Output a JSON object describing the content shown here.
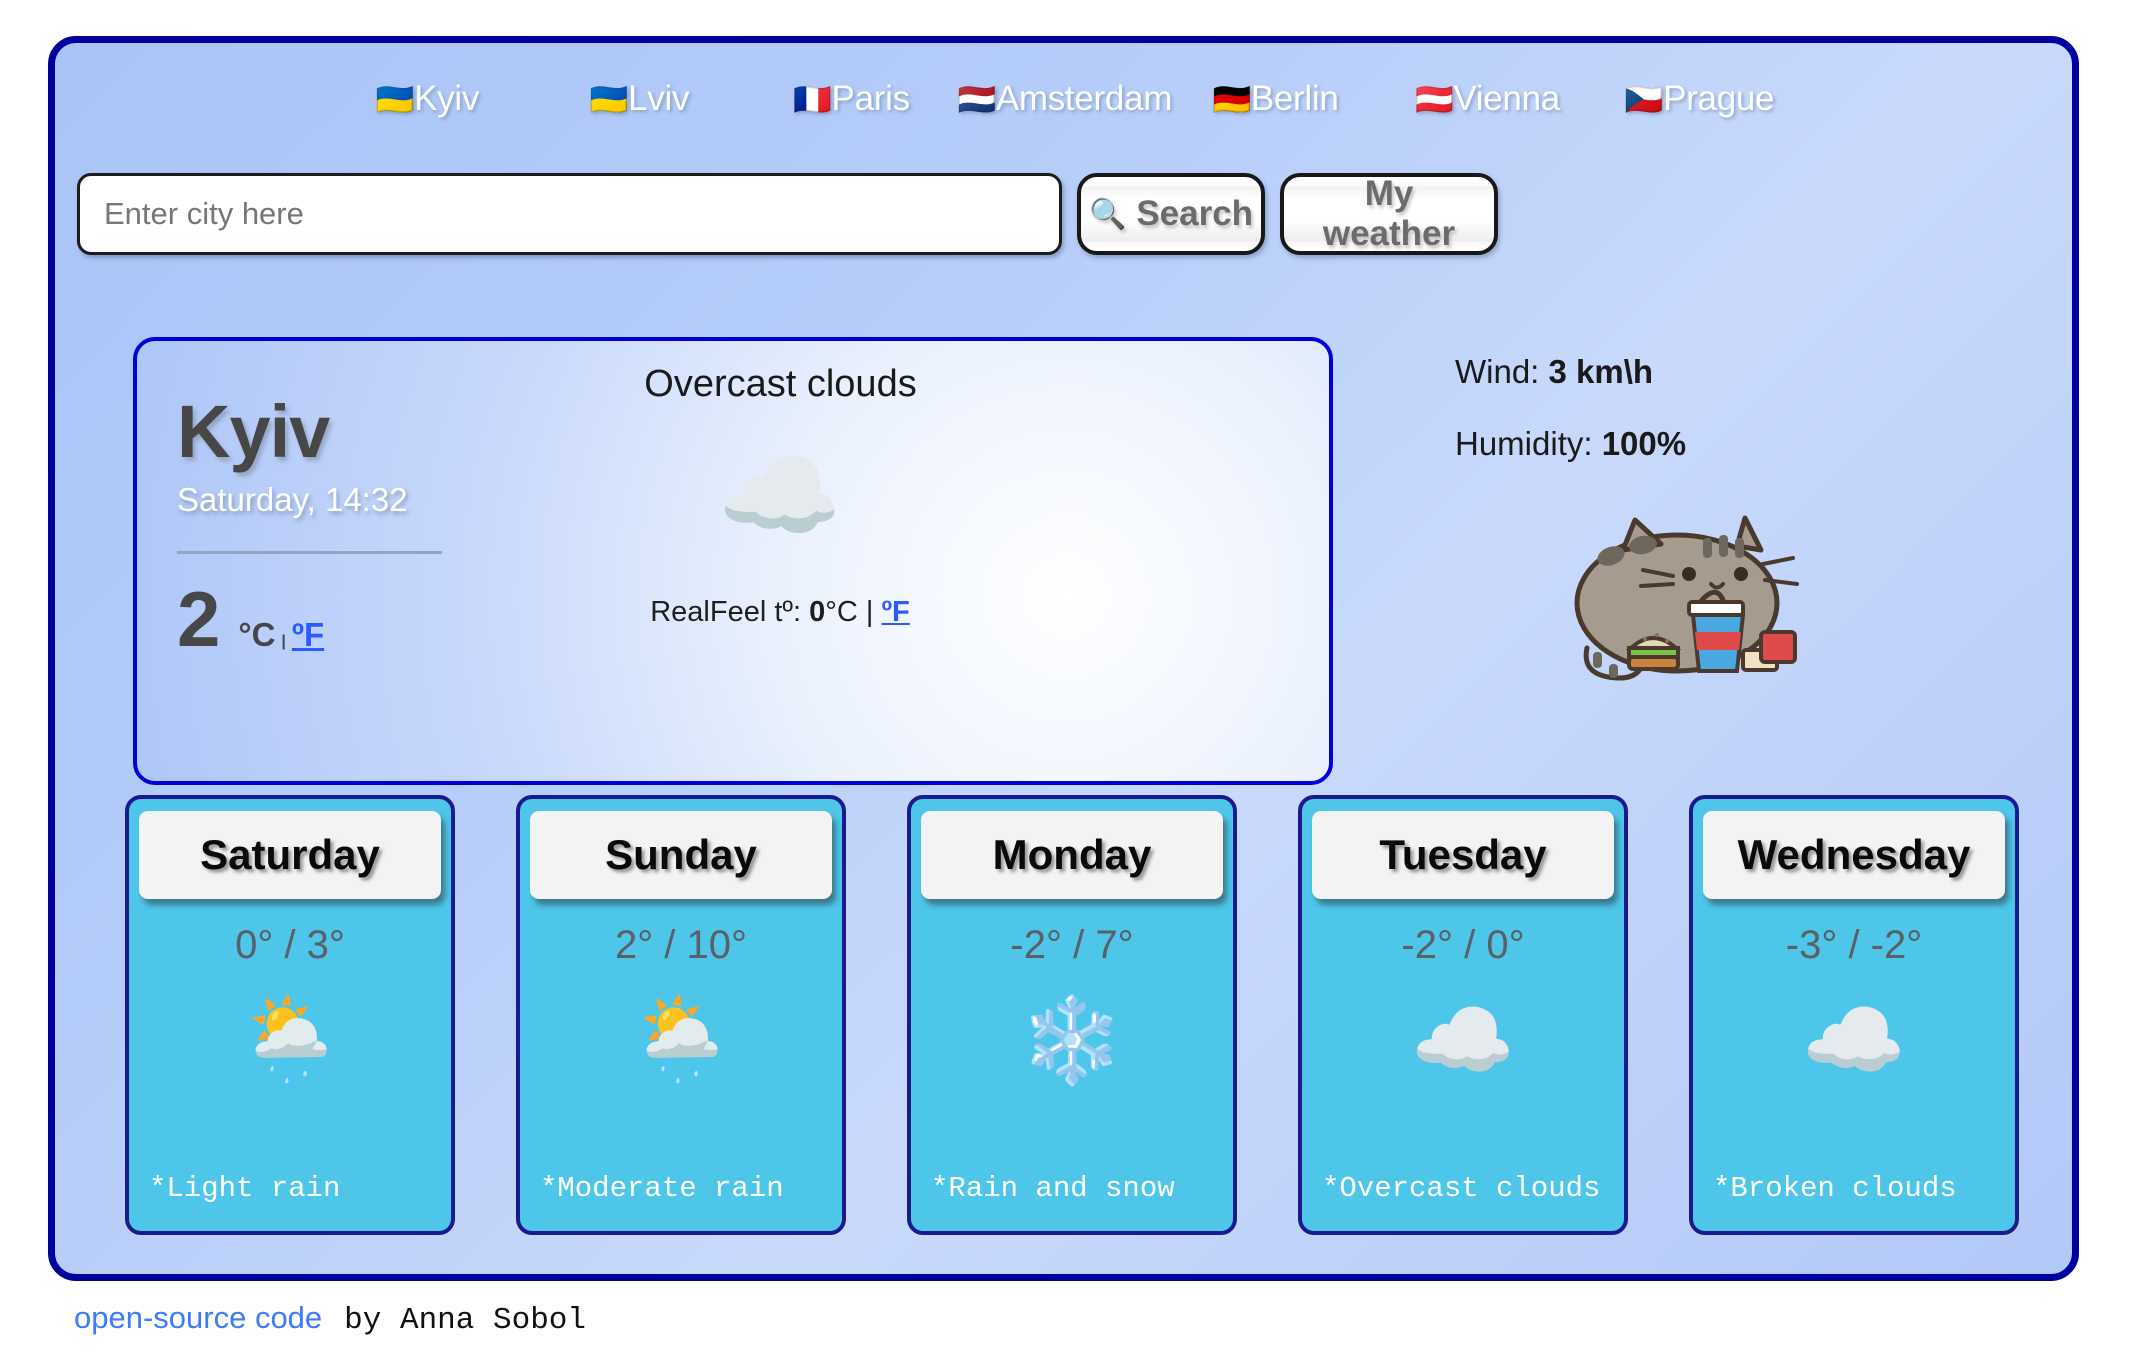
{
  "nav": {
    "items": [
      {
        "flag": "🇺🇦",
        "label": "Kyiv",
        "name": "nav-link-kyiv"
      },
      {
        "flag": "🇺🇦",
        "label": "Lviv",
        "name": "nav-link-lviv"
      },
      {
        "flag": "🇫🇷",
        "label": "Paris",
        "name": "nav-link-paris"
      },
      {
        "flag": "🇳🇱",
        "label": "Amsterdam",
        "name": "nav-link-amsterdam"
      },
      {
        "flag": "🇩🇪",
        "label": "Berlin",
        "name": "nav-link-berlin"
      },
      {
        "flag": "🇦🇹",
        "label": "Vienna",
        "name": "nav-link-vienna"
      },
      {
        "flag": "🇨🇿",
        "label": "Prague",
        "name": "nav-link-prague"
      }
    ]
  },
  "search": {
    "placeholder": "Enter city here",
    "value": "",
    "search_button": "Search",
    "search_icon": "🔍",
    "my_weather_button": "My weather"
  },
  "current": {
    "city": "Kyiv",
    "datetime": "Saturday, 14:32",
    "temperature": "2",
    "unit_current": "°C",
    "unit_separator": "|",
    "unit_link": "ºF",
    "condition": "Overcast clouds",
    "condition_icon": "☁️",
    "realfeel_label": "RealFeel tº:",
    "realfeel_value": "0",
    "realfeel_unit": "°C",
    "realfeel_separator": "|",
    "realfeel_link": "ºF"
  },
  "details": {
    "wind_label": "Wind:",
    "wind_value": "3 km\\h",
    "humidity_label": "Humidity:",
    "humidity_value": "100%",
    "mascot_name": "pusheen-cat-with-fastfood"
  },
  "forecast": [
    {
      "day": "Saturday",
      "temps": "0° / 3°",
      "icon": "🌦️",
      "desc": "*Light rain"
    },
    {
      "day": "Sunday",
      "temps": "2° / 10°",
      "icon": "🌦️",
      "desc": "*Moderate rain"
    },
    {
      "day": "Monday",
      "temps": "-2° / 7°",
      "icon": "❄️",
      "desc": "*Rain and snow"
    },
    {
      "day": "Tuesday",
      "temps": "-2° / 0°",
      "icon": "☁️",
      "desc": "*Overcast clouds"
    },
    {
      "day": "Wednesday",
      "temps": "-3° / -2°",
      "icon": "☁️",
      "desc": "*Broken clouds"
    }
  ],
  "footer": {
    "link": "open-source code",
    "author": "by Anna Sobol"
  },
  "colors": {
    "frame_border": "#0000a0",
    "card_border": "#0000d8",
    "forecast_bg": "#4ec6ea",
    "forecast_border": "#1a1a8f",
    "link_blue": "#2a5bff",
    "footer_link": "#3d7bfa"
  }
}
